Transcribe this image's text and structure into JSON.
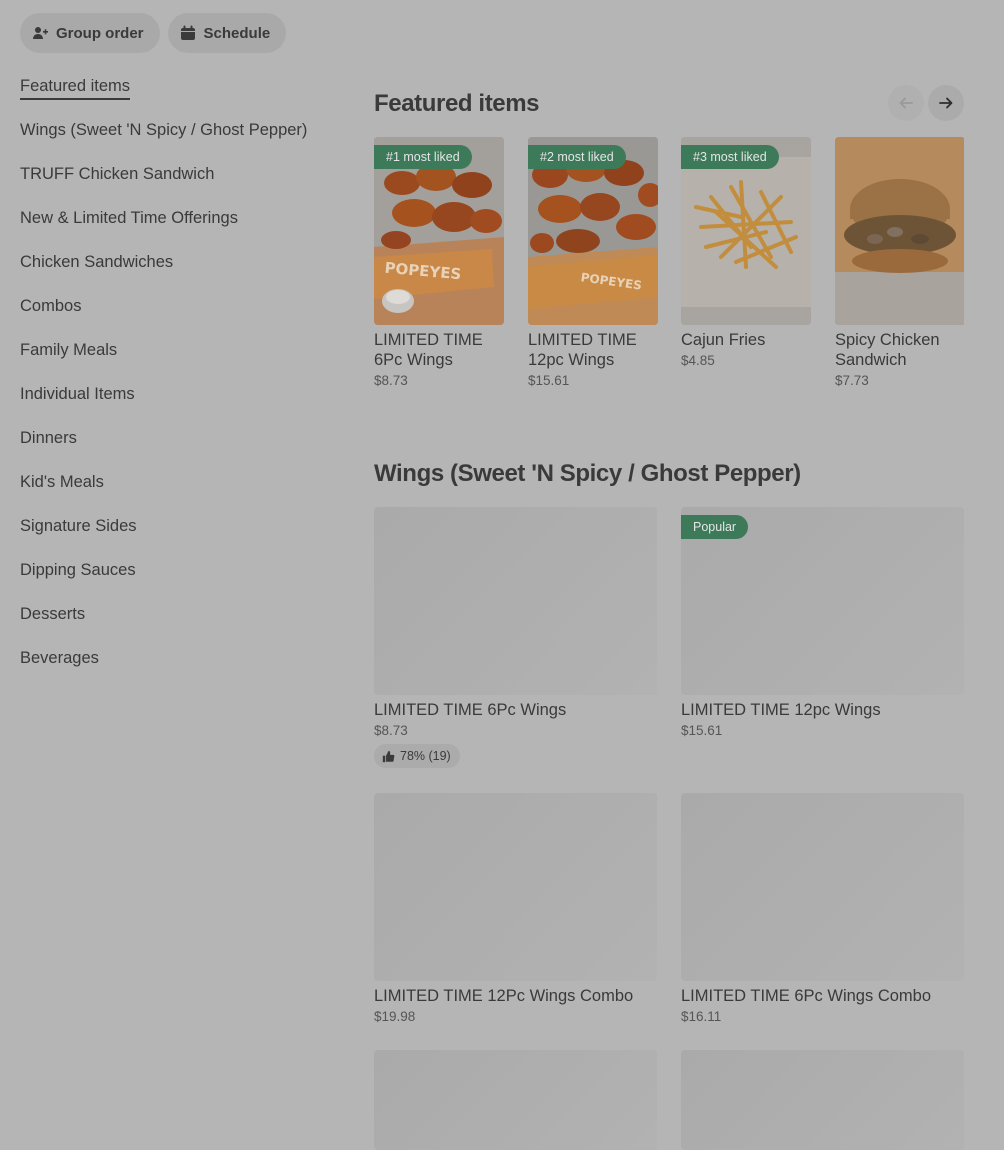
{
  "top_actions": {
    "group_order": "Group order",
    "schedule": "Schedule"
  },
  "sidebar": {
    "items": [
      {
        "label": "Featured items"
      },
      {
        "label": "Wings (Sweet 'N Spicy / Ghost Pepper)"
      },
      {
        "label": "TRUFF Chicken Sandwich"
      },
      {
        "label": "New & Limited Time Offerings"
      },
      {
        "label": "Chicken Sandwiches"
      },
      {
        "label": "Combos"
      },
      {
        "label": "Family Meals"
      },
      {
        "label": "Individual Items"
      },
      {
        "label": "Dinners"
      },
      {
        "label": "Kid's Meals"
      },
      {
        "label": "Signature Sides"
      },
      {
        "label": "Dipping Sauces"
      },
      {
        "label": "Desserts"
      },
      {
        "label": "Beverages"
      }
    ]
  },
  "featured": {
    "title": "Featured items",
    "items": [
      {
        "badge": "#1 most liked",
        "name": "LIMITED TIME 6Pc Wings",
        "price": "$8.73",
        "image": "wings-6pc-box"
      },
      {
        "badge": "#2 most liked",
        "name": "LIMITED TIME 12pc Wings",
        "price": "$15.61",
        "image": "wings-12pc-box"
      },
      {
        "badge": "#3 most liked",
        "name": "Cajun Fries",
        "price": "$4.85",
        "image": "cajun-fries"
      },
      {
        "badge": "",
        "name": "Spicy Chicken Sandwich",
        "price": "$7.73",
        "image": "chicken-sandwich"
      }
    ]
  },
  "wings": {
    "title": "Wings (Sweet 'N Spicy / Ghost Pepper)",
    "items": [
      {
        "name": "LIMITED TIME 6Pc Wings",
        "price": "$8.73",
        "rating": "78% (19)",
        "badge": ""
      },
      {
        "name": "LIMITED TIME 12pc Wings",
        "price": "$15.61",
        "rating": "",
        "badge": "Popular"
      },
      {
        "name": "LIMITED TIME 12Pc Wings Combo",
        "price": "$19.98",
        "rating": "",
        "badge": ""
      },
      {
        "name": "LIMITED TIME 6Pc Wings Combo",
        "price": "$16.11",
        "rating": "",
        "badge": ""
      }
    ]
  },
  "colors": {
    "overlay_bg": "#b5b5b5",
    "badge_green": "#3d7a5a",
    "text": "#3a3a3a"
  }
}
